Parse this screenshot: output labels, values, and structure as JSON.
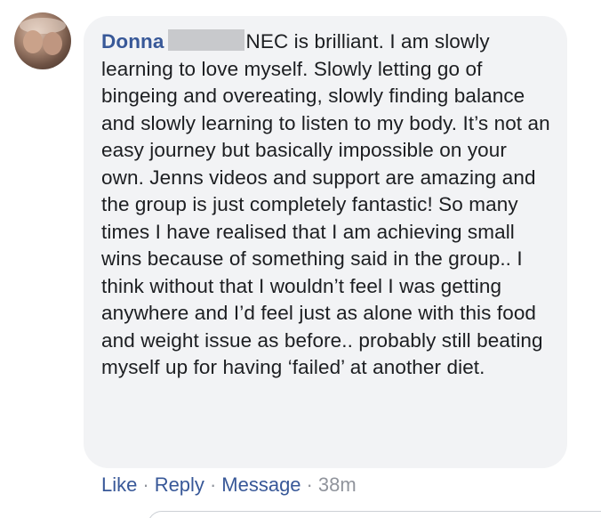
{
  "comment": {
    "author": "Donna",
    "text": "NEC is brilliant. I am slowly learning to love myself. Slowly letting go of bingeing and overeating, slowly finding balance and slowly learning to listen to my body. It’s not an easy journey but basically impossible on your own. Jenns videos and support are amazing and the group is just completely fantastic! So many times I have realised that I am achieving small wins because of something said in the group.. I think without that I wouldn’t feel I was getting anywhere and I’d feel just as alone with this food and weight issue as before.. probably still beating myself up for having ‘failed’ at another diet.",
    "avatar_icon": "profile-photo",
    "redaction_color": "#c8c9cc"
  },
  "actions": {
    "like_label": "Like",
    "reply_label": "Reply",
    "message_label": "Message",
    "separator": "·",
    "timestamp": "38m"
  },
  "colors": {
    "link": "#385898",
    "bubble_background": "#f2f3f5",
    "text": "#1c1e21",
    "meta": "#90949c"
  }
}
